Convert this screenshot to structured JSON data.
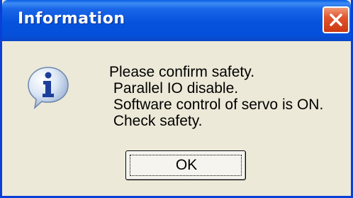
{
  "dialog": {
    "title": "Information",
    "icon": "info-icon",
    "message_lines": [
      "Please confirm safety.",
      " Parallel IO disable.",
      " Software control of servo is ON.",
      " Check safety."
    ],
    "ok_label": "OK"
  },
  "colors": {
    "titlebar": "#0552dd",
    "window_bg": "#ece9d8",
    "close_button": "#e0552f",
    "title_text": "#ffffff"
  }
}
